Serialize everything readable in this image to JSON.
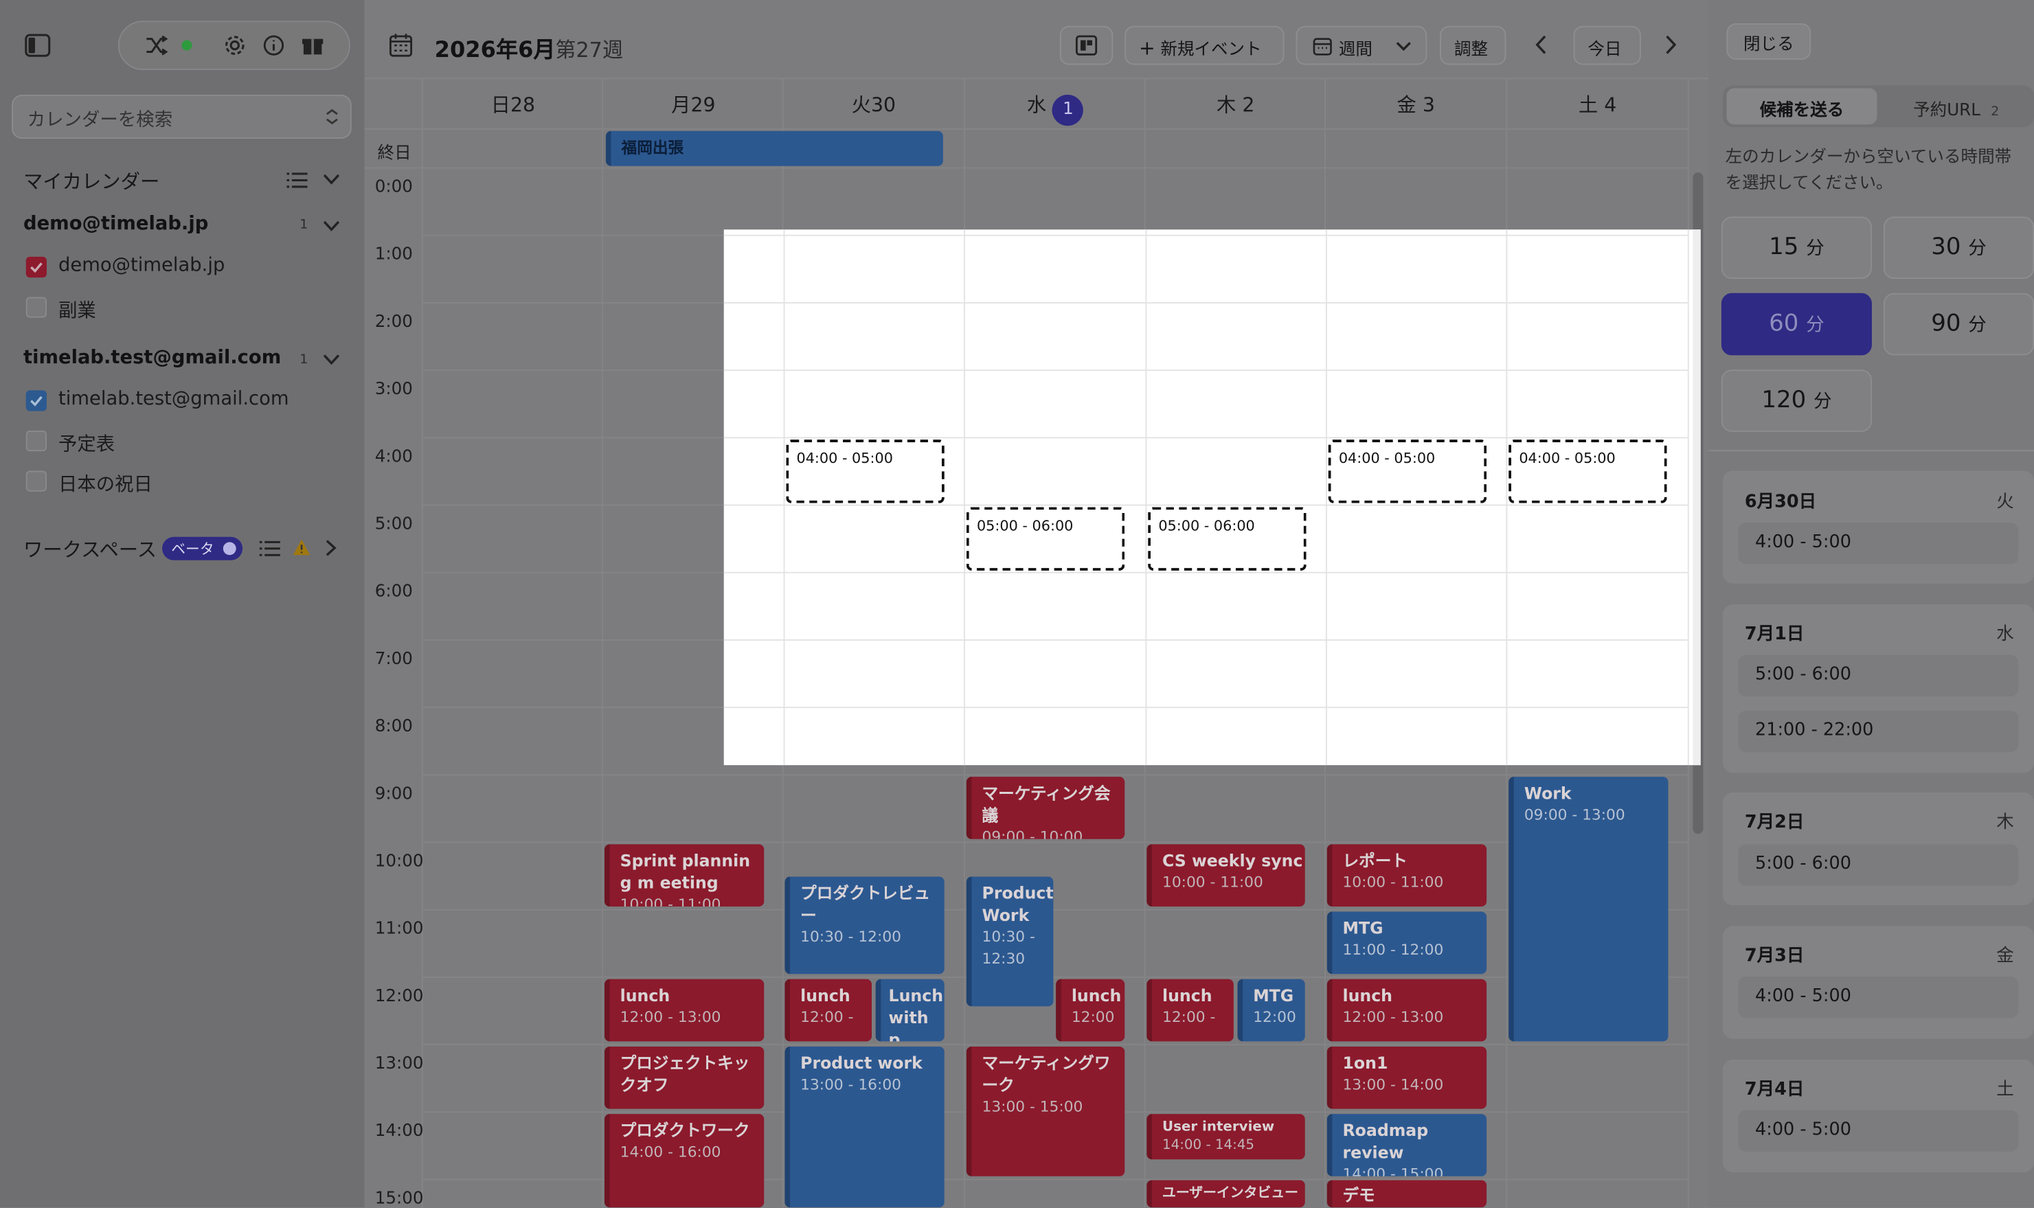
{
  "sidebar": {
    "search_placeholder": "カレンダーを検索",
    "my_calendars_title": "マイカレンダー",
    "accounts": [
      {
        "email": "demo@timelab.jp",
        "count": "1",
        "calendars": [
          {
            "label": "demo@timelab.jp",
            "checked": true,
            "color": "#8d1a2d"
          },
          {
            "label": "副業",
            "checked": false
          }
        ]
      },
      {
        "email": "timelab.test@gmail.com",
        "count": "1",
        "calendars": [
          {
            "label": "timelab.test@gmail.com",
            "checked": true,
            "color": "#2c5a90"
          },
          {
            "label": "予定表",
            "checked": false
          },
          {
            "label": "日本の祝日",
            "checked": false
          }
        ]
      }
    ],
    "workspace_title": "ワークスペース",
    "beta_label": "ベータ"
  },
  "header": {
    "month_label": "2026年6月",
    "week_label": "第27週",
    "new_event_label": "新規イベント",
    "view_label": "週間",
    "adjust_label": "調整",
    "today_label": "今日"
  },
  "days": [
    {
      "dow": "日",
      "num": "28"
    },
    {
      "dow": "月",
      "num": "29"
    },
    {
      "dow": "火",
      "num": "30"
    },
    {
      "dow": "水",
      "num": "1",
      "today": true
    },
    {
      "dow": "木",
      "num": "2"
    },
    {
      "dow": "金",
      "num": "3"
    },
    {
      "dow": "土",
      "num": "4"
    }
  ],
  "all_day_label": "終日",
  "all_day_event": "福岡出張",
  "hours": [
    "0:00",
    "1:00",
    "2:00",
    "3:00",
    "4:00",
    "5:00",
    "6:00",
    "7:00",
    "8:00",
    "9:00",
    "10:00",
    "11:00",
    "12:00",
    "13:00",
    "14:00",
    "15:00"
  ],
  "events": [
    {
      "title": "マーケティング会議",
      "time": "09:00 - 10:00",
      "color": "red"
    },
    {
      "title": "Work",
      "time": "09:00 - 13:00",
      "color": "blue"
    },
    {
      "title": "Sprint planning m eeting",
      "time": "10:00 - 11:00",
      "color": "red"
    },
    {
      "title": "CS weekly sync",
      "time": "10:00 - 11:00",
      "color": "red"
    },
    {
      "title": "レポート",
      "time": "10:00 - 11:00",
      "color": "red"
    },
    {
      "title": "プロダクトレビュー",
      "time": "10:30 - 12:00",
      "color": "blue"
    },
    {
      "title": "Product Work",
      "time": "10:30 - 12:30",
      "color": "blue"
    },
    {
      "title": "MTG",
      "time": "11:00 - 12:00",
      "color": "blue"
    },
    {
      "title": "lunch",
      "time": "12:00 - 13:00",
      "color": "red"
    },
    {
      "title": "lunch",
      "time": "12:00 -",
      "color": "red"
    },
    {
      "title": "Lunch with p",
      "time": "",
      "color": "blue"
    },
    {
      "title": "lunch",
      "time": "12:00",
      "color": "red"
    },
    {
      "title": "lunch",
      "time": "12:00 -",
      "color": "red"
    },
    {
      "title": "MTG",
      "time": "12:00",
      "color": "blue"
    },
    {
      "title": "lunch",
      "time": "12:00 - 13:00",
      "color": "red"
    },
    {
      "title": "プロジェクトキックオフ",
      "time": "",
      "color": "red"
    },
    {
      "title": "Product work",
      "time": "13:00 - 16:00",
      "color": "blue"
    },
    {
      "title": "マーケティングワーク",
      "time": "13:00 - 15:00",
      "color": "red"
    },
    {
      "title": "1on1",
      "time": "13:00 - 14:00",
      "color": "red"
    },
    {
      "title": "プロダクトワーク",
      "time": "14:00 - 16:00",
      "color": "red"
    },
    {
      "title": "User interview",
      "time": "14:00 - 14:45",
      "color": "red"
    },
    {
      "title": "Roadmap review",
      "time": "14:00 - 15:00",
      "color": "blue"
    },
    {
      "title": "ユーザーインタビュー",
      "time": "",
      "color": "red"
    },
    {
      "title": "デモ",
      "time": "",
      "color": "red"
    }
  ],
  "slots": [
    "04:00 - 05:00",
    "05:00 - 06:00",
    "05:00 - 06:00",
    "04:00 - 05:00",
    "04:00 - 05:00"
  ],
  "right_panel": {
    "close_label": "閉じる",
    "tab_send": "候補を送る",
    "tab_url": "予約URL",
    "tab_url_count": "2",
    "instruction": "左のカレンダーから空いている時間帯を選択してください。",
    "durations": [
      {
        "value": "15",
        "unit": "分"
      },
      {
        "value": "30",
        "unit": "分"
      },
      {
        "value": "60",
        "unit": "分",
        "selected": true
      },
      {
        "value": "90",
        "unit": "分"
      },
      {
        "value": "120",
        "unit": "分"
      }
    ],
    "candidates": [
      {
        "date": "6月30日",
        "dow": "火",
        "times": [
          "4:00 - 5:00"
        ]
      },
      {
        "date": "7月1日",
        "dow": "水",
        "times": [
          "5:00 - 6:00",
          "21:00 - 22:00"
        ]
      },
      {
        "date": "7月2日",
        "dow": "木",
        "times": [
          "5:00 - 6:00"
        ]
      },
      {
        "date": "7月3日",
        "dow": "金",
        "times": [
          "4:00 - 5:00"
        ]
      },
      {
        "date": "7月4日",
        "dow": "土",
        "times": [
          "4:00 - 5:00"
        ]
      }
    ]
  }
}
